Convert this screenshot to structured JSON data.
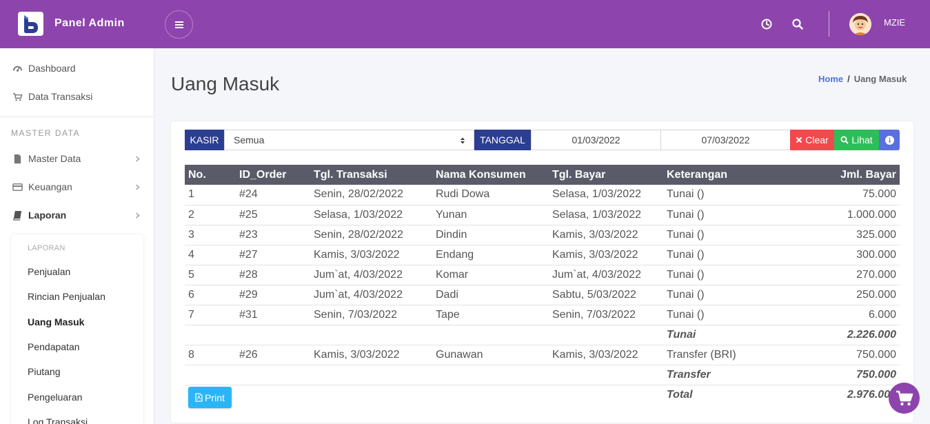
{
  "app": {
    "brand": "Panel Admin",
    "username": "MZIE"
  },
  "colors": {
    "topbar": "#8e44ad",
    "tag": "#2c3e91",
    "clear": "#f5484d",
    "lihat": "#2ebd59",
    "info": "#5a6fe0",
    "print": "#29b6f6",
    "table_header": "#5b5a69"
  },
  "topbar": {
    "icons": [
      "menu-icon",
      "clock-icon",
      "search-icon",
      "avatar"
    ]
  },
  "sidebar": {
    "items": [
      {
        "label": "Dashboard",
        "icon": "dashboard-icon"
      },
      {
        "label": "Data Transaksi",
        "icon": "cart-icon"
      }
    ],
    "section_header": "MASTER DATA",
    "master_items": [
      {
        "label": "Master Data",
        "icon": "file-icon"
      },
      {
        "label": "Keuangan",
        "icon": "credit-card-icon"
      },
      {
        "label": "Laporan",
        "icon": "book-icon"
      }
    ],
    "submenu": {
      "header": "LAPORAN",
      "items": [
        "Penjualan",
        "Rincian Penjualan",
        "Uang Masuk",
        "Pendapatan",
        "Piutang",
        "Pengeluaran",
        "Log Transaksi"
      ],
      "active": "Uang Masuk"
    }
  },
  "page": {
    "title": "Uang Masuk",
    "breadcrumb": {
      "home": "Home",
      "sep": "/",
      "current": "Uang Masuk"
    }
  },
  "filter": {
    "kasir_label": "KASIR",
    "kasir_value": "Semua",
    "tanggal_label": "TANGGAL",
    "date_from": "01/03/2022",
    "date_to": "07/03/2022",
    "clear_label": "Clear",
    "lihat_label": "Lihat"
  },
  "table": {
    "headers": [
      "No.",
      "ID_Order",
      "Tgl. Transaksi",
      "Nama Konsumen",
      "Tgl. Bayar",
      "Keterangan",
      "Jml. Bayar"
    ],
    "rows": [
      [
        "1",
        "#24",
        "Senin, 28/02/2022",
        "Rudi Dowa",
        "Selasa, 1/03/2022",
        "Tunai ()",
        "75.000"
      ],
      [
        "2",
        "#25",
        "Selasa, 1/03/2022",
        "Yunan",
        "Selasa, 1/03/2022",
        "Tunai ()",
        "1.000.000"
      ],
      [
        "3",
        "#23",
        "Senin, 28/02/2022",
        "Dindin",
        "Kamis, 3/03/2022",
        "Tunai ()",
        "325.000"
      ],
      [
        "4",
        "#27",
        "Kamis, 3/03/2022",
        "Endang",
        "Kamis, 3/03/2022",
        "Tunai ()",
        "300.000"
      ],
      [
        "5",
        "#28",
        "Jum`at, 4/03/2022",
        "Komar",
        "Jum`at, 4/03/2022",
        "Tunai ()",
        "270.000"
      ],
      [
        "6",
        "#29",
        "Jum`at, 4/03/2022",
        "Dadi",
        "Sabtu, 5/03/2022",
        "Tunai ()",
        "250.000"
      ],
      [
        "7",
        "#31",
        "Senin, 7/03/2022",
        "Tape",
        "Senin, 7/03/2022",
        "Tunai ()",
        "6.000"
      ]
    ],
    "subtotal_tunai": {
      "label": "Tunai",
      "value": "2.226.000"
    },
    "rows2": [
      [
        "8",
        "#26",
        "Kamis, 3/03/2022",
        "Gunawan",
        "Kamis, 3/03/2022",
        "Transfer (BRI)",
        "750.000"
      ]
    ],
    "subtotal_transfer": {
      "label": "Transfer",
      "value": "750.000"
    },
    "total": {
      "label": "Total",
      "value": "2.976.000"
    }
  },
  "actions": {
    "print_label": "Print"
  }
}
